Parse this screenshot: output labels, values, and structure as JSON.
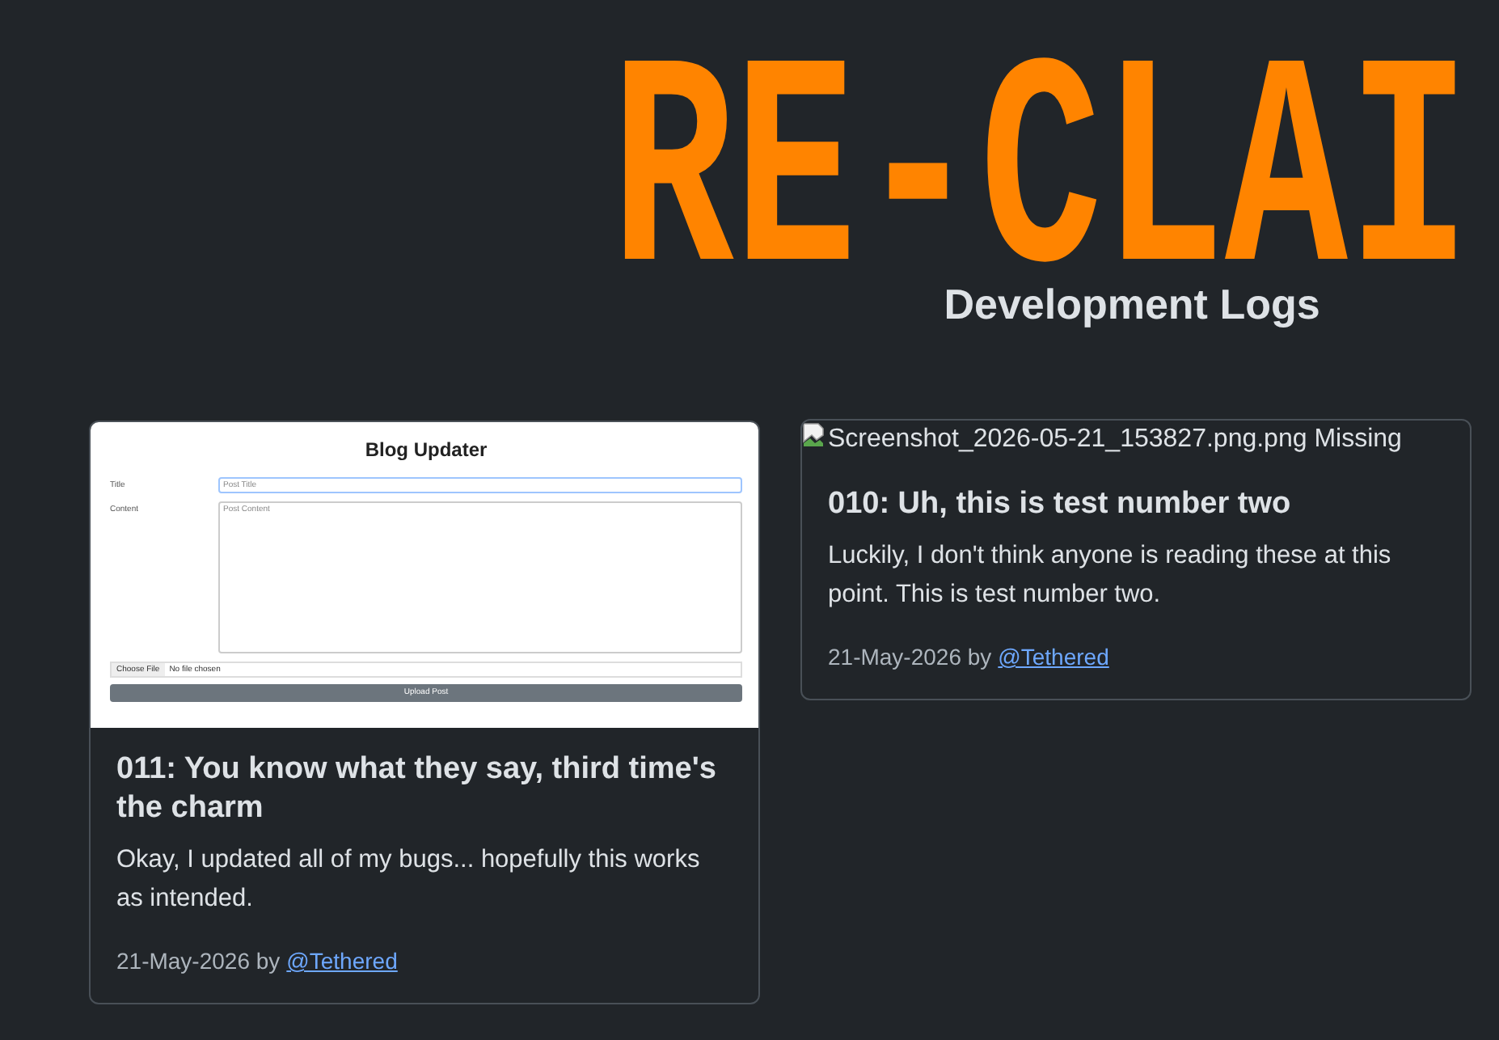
{
  "header": {
    "logo": "RE-CLAI",
    "subtitle": "Development Logs"
  },
  "posts": [
    {
      "image": {
        "kind": "screenshot",
        "form": {
          "title": "Blog Updater",
          "title_label": "Title",
          "title_placeholder": "Post Title",
          "content_label": "Content",
          "content_placeholder": "Post Content",
          "file_button": "Choose File",
          "file_status": "No file chosen",
          "submit": "Upload Post"
        }
      },
      "title": "011: You know what they say, third time's the charm",
      "body": "Okay, I updated all of my bugs... hopefully this works as intended.",
      "date": "21-May-2026 by",
      "author": "@Tethered"
    },
    {
      "image": {
        "kind": "missing",
        "alt": "Screenshot_2026-05-21_153827.png.png Missing"
      },
      "title": "010: Uh, this is test number two",
      "body": "Luckily, I don't think anyone is reading these at this point. This is test number two.",
      "date": "21-May-2026 by",
      "author": "@Tethered"
    }
  ]
}
